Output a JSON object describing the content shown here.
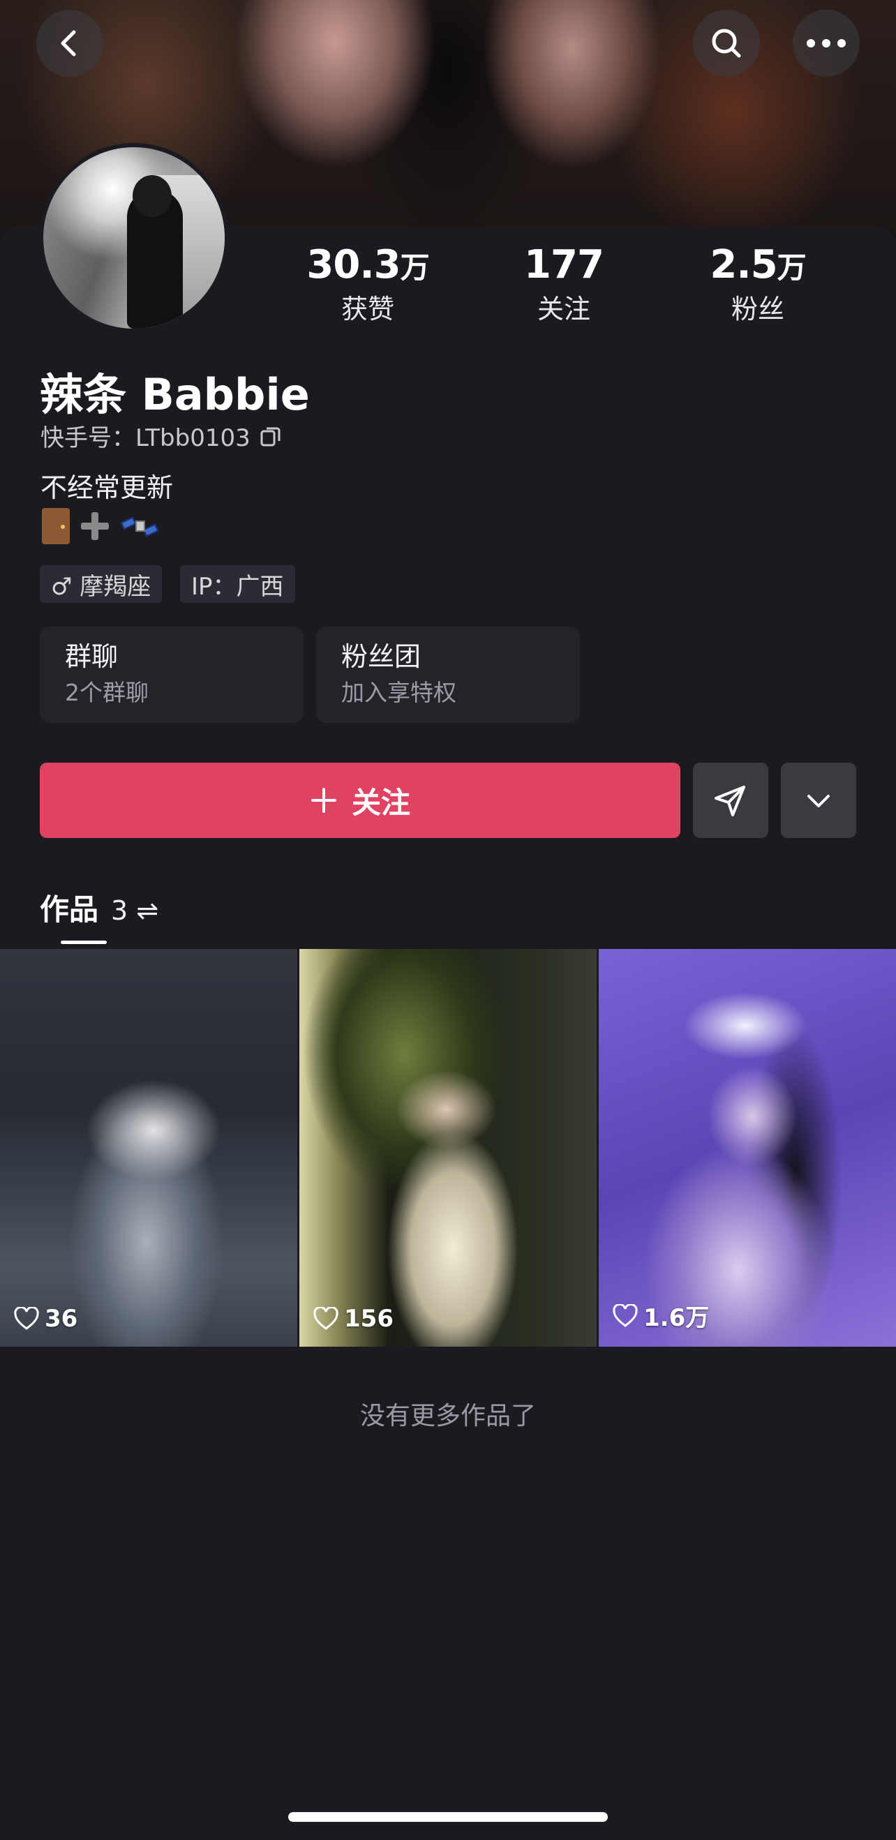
{
  "header": {
    "back_icon": "chevron-left-icon",
    "search_icon": "search-icon",
    "more_icon": "more-icon"
  },
  "stats": [
    {
      "value": "30.3",
      "unit": "万",
      "label": "获赞"
    },
    {
      "value": "177",
      "unit": "",
      "label": "关注"
    },
    {
      "value": "2.5",
      "unit": "万",
      "label": "粉丝"
    }
  ],
  "profile": {
    "name": "辣条 Babbie",
    "kuaishou_id": "快手号：LTbb0103",
    "bio": "不经常更新",
    "tags": [
      "♂ 摩羯座",
      "IP：广西"
    ]
  },
  "cards": [
    {
      "title": "群聊",
      "subtitle": "2个群聊"
    },
    {
      "title": "粉丝团",
      "subtitle": "加入享特权"
    }
  ],
  "actions": {
    "follow_label": "关注",
    "accent_color": "#df4361"
  },
  "works": {
    "tab_label": "作品",
    "count": "3",
    "sort_icon": "⇌",
    "items": [
      {
        "likes": "36"
      },
      {
        "likes": "156"
      },
      {
        "likes": "1.6万"
      }
    ],
    "no_more": "没有更多作品了"
  }
}
